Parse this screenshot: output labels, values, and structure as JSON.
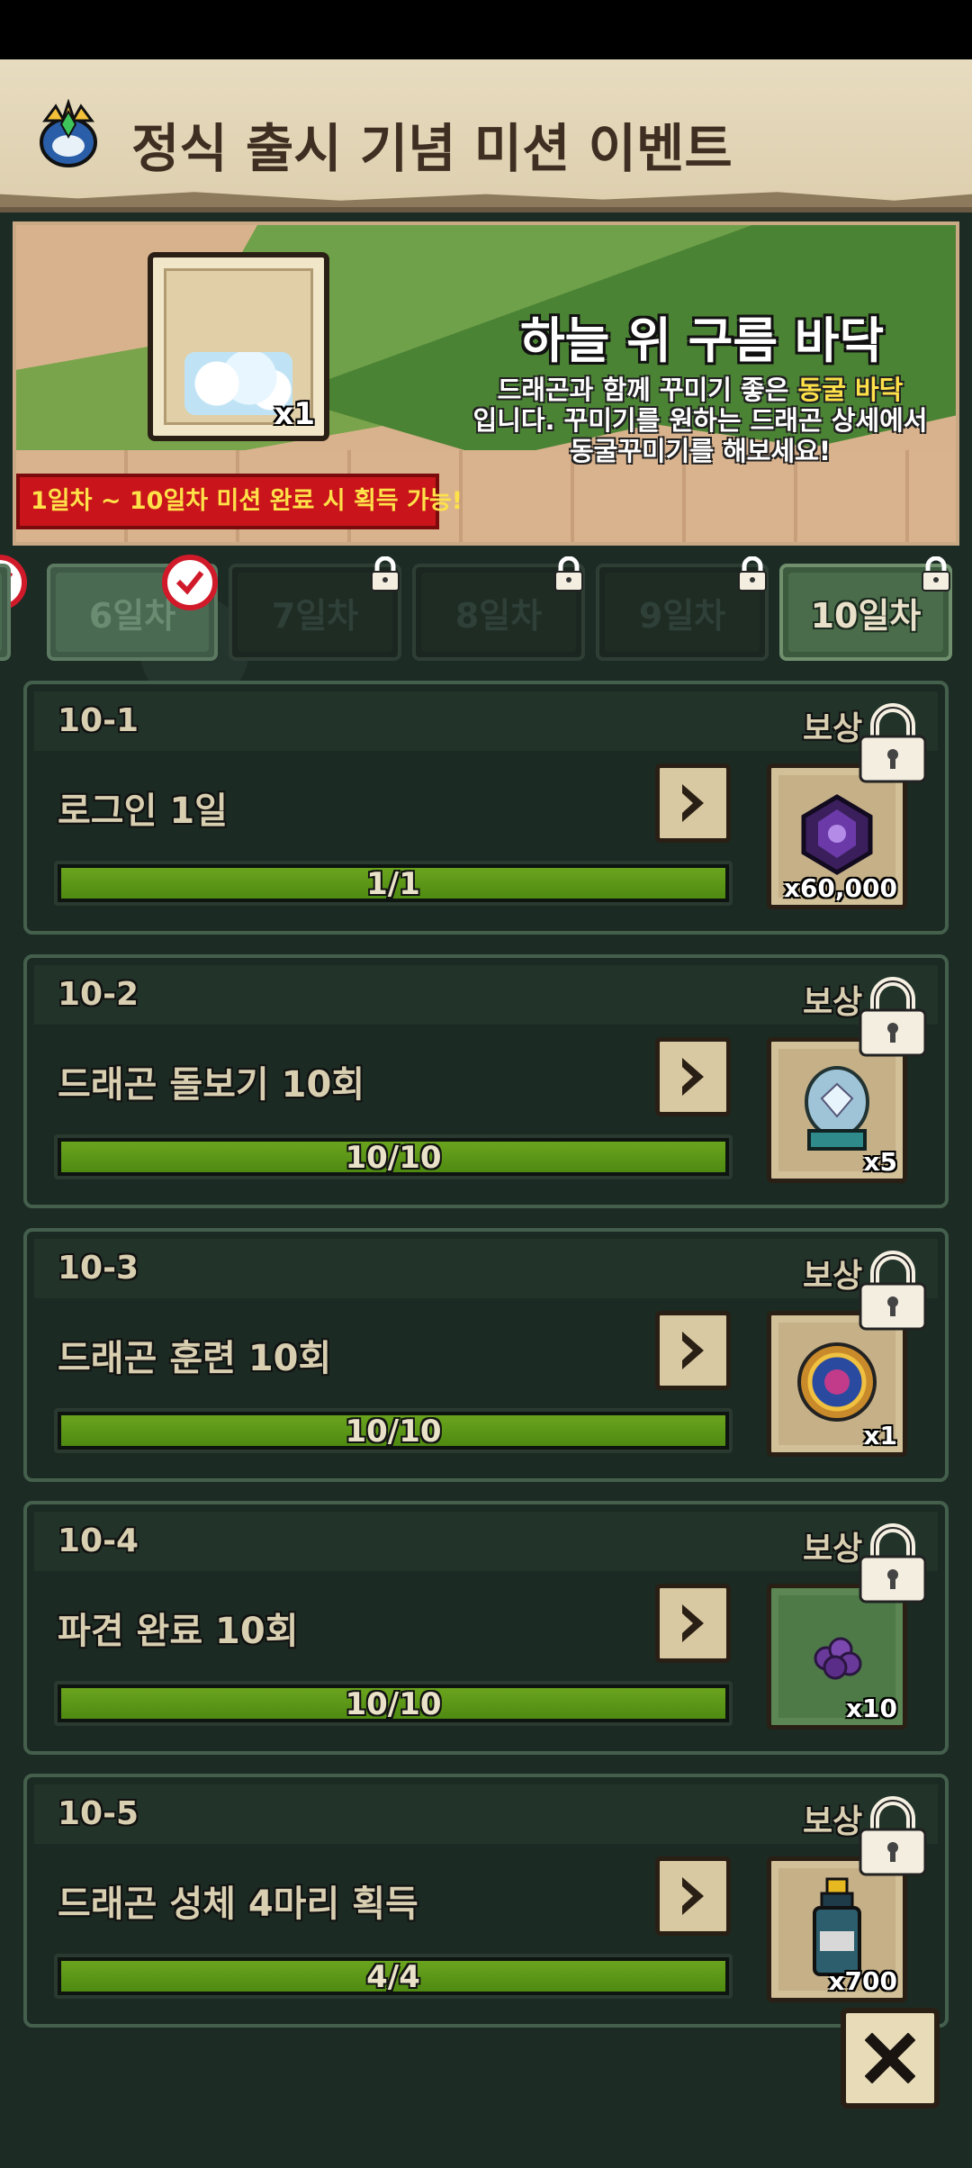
{
  "header": {
    "title": "정식 출시 기념 미션 이벤트"
  },
  "banner": {
    "item_qty": "x1",
    "title": "하늘 위 구름 바닥",
    "desc_part1": "드래곤과 함께 꾸미기 좋은 ",
    "desc_highlight": "동굴 바닥",
    "desc_part2": "입니다. 꾸미기를 원하는 드래곤 상세에서 동굴꾸미기를 해보세요!",
    "ribbon": "1일차 ~ 10일차 미션 완료 시 획득 가능!"
  },
  "tabs": [
    {
      "label": "6일차"
    },
    {
      "label": "7일차"
    },
    {
      "label": "8일차"
    },
    {
      "label": "9일차"
    },
    {
      "label": "10일차"
    }
  ],
  "reward_label": "보상",
  "missions": [
    {
      "num": "10-1",
      "name": "로그인 1일",
      "progress_text": "1/1",
      "progress": 1.0,
      "reward_qty": "x60,000",
      "reward_icon": "dark-crystal-icon"
    },
    {
      "num": "10-2",
      "name": "드래곤 돌보기 10회",
      "progress_text": "10/10",
      "progress": 1.0,
      "reward_qty": "x5",
      "reward_icon": "diamond-dome-icon"
    },
    {
      "num": "10-3",
      "name": "드래곤 훈련 10회",
      "progress_text": "10/10",
      "progress": 1.0,
      "reward_qty": "x1",
      "reward_icon": "medal-icon"
    },
    {
      "num": "10-4",
      "name": "파견 완료 10회",
      "progress_text": "10/10",
      "progress": 1.0,
      "reward_qty": "x10",
      "reward_icon": "grape-icon"
    },
    {
      "num": "10-5",
      "name": "드래곤 성체 4마리 획득",
      "progress_text": "4/4",
      "progress": 1.0,
      "reward_qty": "x700",
      "reward_icon": "potion-bottle-icon"
    }
  ]
}
